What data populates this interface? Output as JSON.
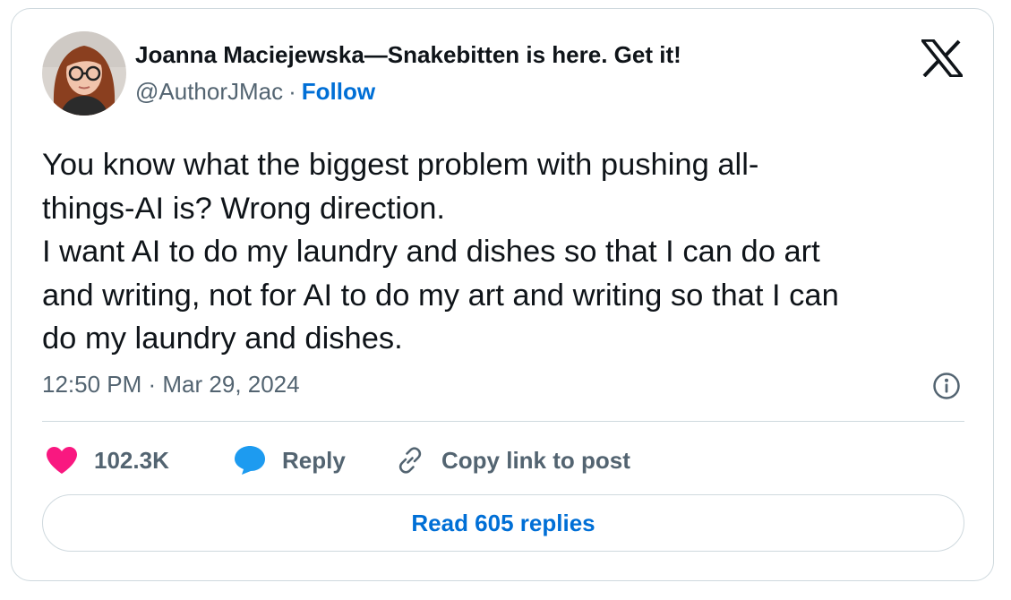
{
  "author": {
    "display_name": "Joanna Maciejewska—Snakebitten is here. Get it!",
    "handle": "@AuthorJMac",
    "separator": "·",
    "follow_label": "Follow",
    "avatar_icon": "author-avatar-photo"
  },
  "brand": {
    "logo_icon": "x-logo-icon"
  },
  "tweet": {
    "lines": [
      "You know what the biggest problem with pushing all-",
      "things-AI is? Wrong direction.",
      "I want AI to do my laundry and dishes so that I can do art",
      "and writing, not for AI to do my art and writing so that I can",
      "do my laundry and dishes."
    ],
    "timestamp": "12:50 PM · Mar 29, 2024",
    "info_icon": "info-icon"
  },
  "actions": {
    "like_count": "102.3K",
    "like_icon": "heart-icon",
    "reply_label": "Reply",
    "reply_icon": "speech-bubble-icon",
    "copy_label": "Copy link to post",
    "copy_icon": "link-icon"
  },
  "footer": {
    "read_replies_label": "Read 605 replies"
  },
  "colors": {
    "text": "#0f1419",
    "muted": "#536471",
    "link": "#006fd6",
    "heart": "#f91880",
    "reply_bubble": "#1d9bf0",
    "border": "#cfd9de"
  }
}
